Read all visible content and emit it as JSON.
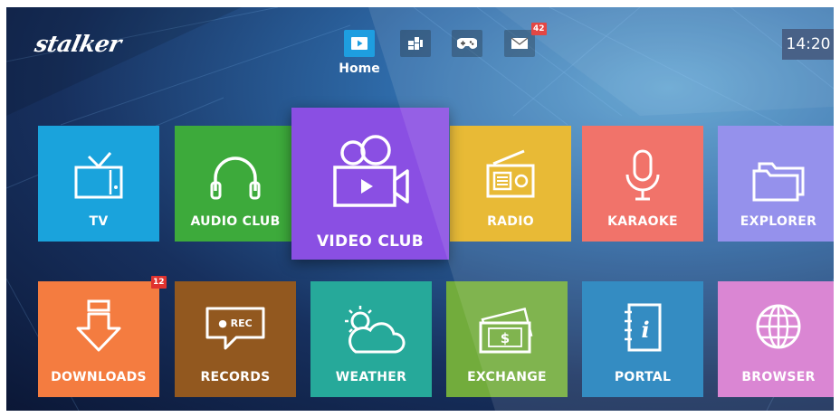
{
  "logo": "stalker",
  "clock": "14:20",
  "nav": {
    "active_label": "Home",
    "items": [
      {
        "name": "home",
        "icon": "play-screen-icon"
      },
      {
        "name": "apps",
        "icon": "apps-icon"
      },
      {
        "name": "games",
        "icon": "gamepad-icon"
      },
      {
        "name": "mail",
        "icon": "mail-icon",
        "badge": "42"
      }
    ]
  },
  "tiles": {
    "tv": {
      "label": "TV",
      "color": "#1aa3dc",
      "icon": "tv-icon"
    },
    "audio_club": {
      "label": "AUDIO CLUB",
      "color": "#3daa3b",
      "icon": "headphones-icon"
    },
    "video_club": {
      "label": "VIDEO CLUB",
      "color": "#8a4fe3",
      "icon": "film-camera-icon"
    },
    "radio": {
      "label": "RADIO",
      "color": "#e6b320",
      "icon": "radio-icon"
    },
    "karaoke": {
      "label": "KARAOKE",
      "color": "#f0645a",
      "icon": "microphone-icon"
    },
    "explorer": {
      "label": "EXPLORER",
      "color": "#8a85ea",
      "icon": "folder-icon"
    },
    "downloads": {
      "label": "DOWNLOADS",
      "color": "#f47c40",
      "icon": "download-icon",
      "badge": "12"
    },
    "records": {
      "label": "RECORDS",
      "color": "#92581f",
      "icon": "rec-bubble-icon",
      "icon_text": "● REC"
    },
    "weather": {
      "label": "WEATHER",
      "color": "#26a99a",
      "icon": "weather-icon"
    },
    "exchange": {
      "label": "EXCHANGE",
      "color": "#72ac3c",
      "icon": "money-icon",
      "icon_text": "$"
    },
    "portal": {
      "label": "PORTAL",
      "color": "#1d7fbb",
      "icon": "info-book-icon",
      "icon_text": "i"
    },
    "browser": {
      "label": "BROWSER",
      "color": "#d679cf",
      "icon": "globe-icon"
    }
  }
}
